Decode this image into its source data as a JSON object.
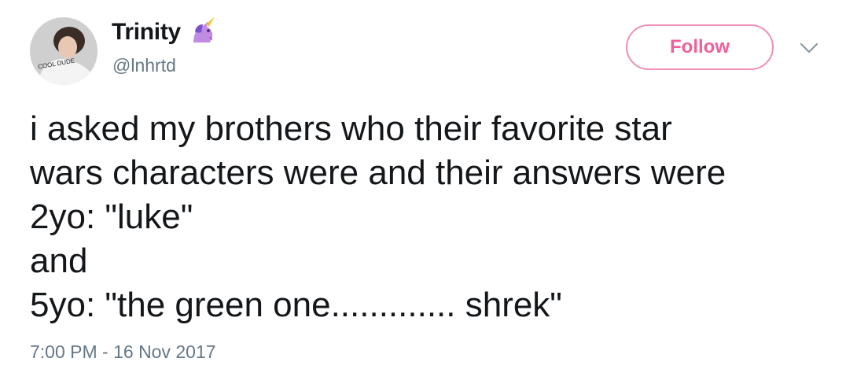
{
  "user": {
    "display_name": "Trinity",
    "handle": "@lnhrtd",
    "avatar_shirt_text": "COOL DUDE"
  },
  "follow_button": {
    "label": "Follow"
  },
  "tweet": {
    "lines": [
      "i asked my brothers who their favorite star",
      "wars characters were and their answers were",
      "2yo: \"luke\"",
      "and",
      "5yo: \"the green one............. shrek\""
    ],
    "timestamp": "7:00 PM - 16 Nov 2017"
  },
  "colors": {
    "follow_accent": "#f0609a",
    "secondary_text": "#657786",
    "primary_text": "#14171a"
  },
  "icons": [
    "unicorn-icon",
    "chevron-down-icon"
  ]
}
